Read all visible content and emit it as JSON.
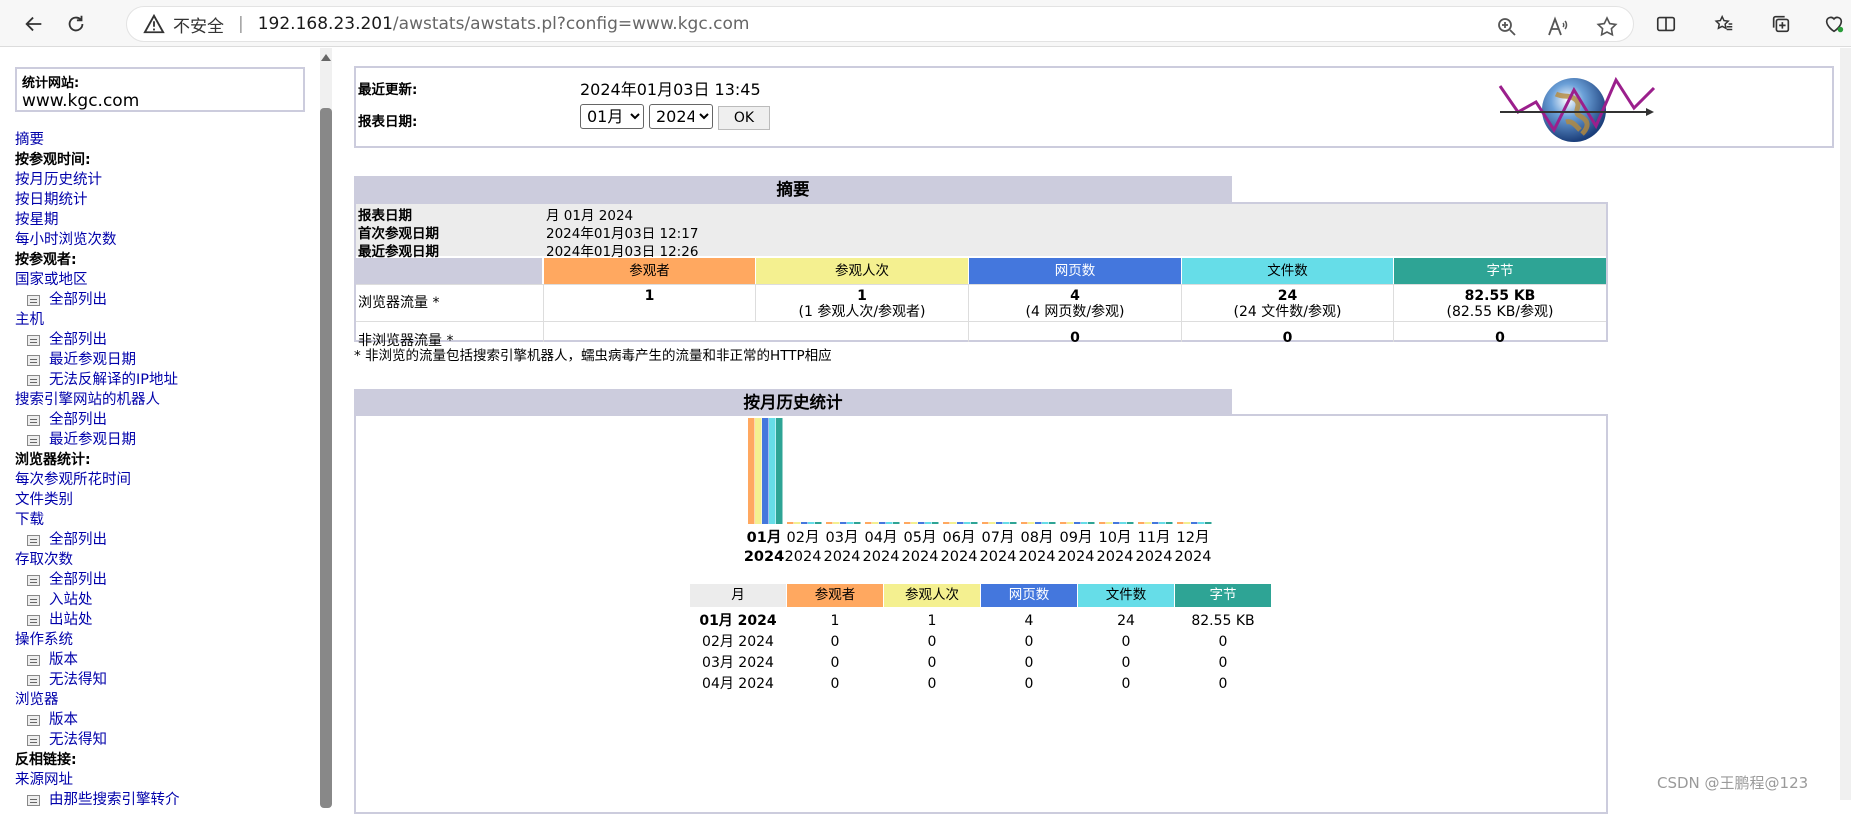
{
  "browser": {
    "insecure_label": "不安全",
    "url_host": "192.168.23.201",
    "url_path": "/awstats/awstats.pl?config=www.kgc.com"
  },
  "sidebar": {
    "site_label": "统计网站:",
    "site_value": "www.kgc.com",
    "items": [
      {
        "type": "link",
        "label": "摘要"
      },
      {
        "type": "head",
        "label": "按参观时间:"
      },
      {
        "type": "link",
        "label": "按月历史统计"
      },
      {
        "type": "link",
        "label": "按日期统计"
      },
      {
        "type": "link",
        "label": "按星期"
      },
      {
        "type": "link",
        "label": "每小时浏览次数"
      },
      {
        "type": "head",
        "label": "按参观者:"
      },
      {
        "type": "link",
        "label": "国家或地区"
      },
      {
        "type": "sub",
        "label": "全部列出"
      },
      {
        "type": "link",
        "label": "主机"
      },
      {
        "type": "sub",
        "label": "全部列出"
      },
      {
        "type": "sub",
        "label": "最近参观日期"
      },
      {
        "type": "sub",
        "label": "无法反解译的IP地址"
      },
      {
        "type": "link",
        "label": "搜索引擎网站的机器人"
      },
      {
        "type": "sub",
        "label": "全部列出"
      },
      {
        "type": "sub",
        "label": "最近参观日期"
      },
      {
        "type": "head",
        "label": "浏览器统计:"
      },
      {
        "type": "link",
        "label": "每次参观所花时间"
      },
      {
        "type": "link",
        "label": "文件类别"
      },
      {
        "type": "link",
        "label": "下载"
      },
      {
        "type": "sub",
        "label": "全部列出"
      },
      {
        "type": "link",
        "label": "存取次数"
      },
      {
        "type": "sub",
        "label": "全部列出"
      },
      {
        "type": "sub",
        "label": "入站处"
      },
      {
        "type": "sub",
        "label": "出站处"
      },
      {
        "type": "link",
        "label": "操作系统"
      },
      {
        "type": "sub",
        "label": "版本"
      },
      {
        "type": "sub",
        "label": "无法得知"
      },
      {
        "type": "link",
        "label": "浏览器"
      },
      {
        "type": "sub",
        "label": "版本"
      },
      {
        "type": "sub",
        "label": "无法得知"
      },
      {
        "type": "head",
        "label": "反相链接:"
      },
      {
        "type": "link",
        "label": "来源网址"
      },
      {
        "type": "sub",
        "label": "由那些搜索引擎转介"
      }
    ]
  },
  "header": {
    "last_update_label": "最近更新:",
    "last_update_value": "2024年01月03日 13:45",
    "report_date_label": "报表日期:",
    "month_select": "01月",
    "year_select": "2024",
    "ok_label": "OK"
  },
  "summary": {
    "title": "摘要",
    "rows": [
      {
        "k": "报表日期",
        "v": "月 01月 2024"
      },
      {
        "k": "首次参观日期",
        "v": "2024年01月03日 12:17"
      },
      {
        "k": "最近参观日期",
        "v": "2024年01月03日 12:26"
      }
    ],
    "columns": [
      "参观者",
      "参观人次",
      "网页数",
      "文件数",
      "字节"
    ],
    "colors": [
      "#ffa860",
      "#f4f090",
      "#4477dd",
      "#66dde8",
      "#2ea495"
    ],
    "browser_traffic_label": "浏览器流量 *",
    "browser_traffic": [
      {
        "main": "1",
        "sub": ""
      },
      {
        "main": "1",
        "sub": "(1 参观人次/参观者)"
      },
      {
        "main": "4",
        "sub": "(4 网页数/参观)"
      },
      {
        "main": "24",
        "sub": "(24 文件数/参观)"
      },
      {
        "main": "82.55 KB",
        "sub": "(82.55 KB/参观)"
      }
    ],
    "non_browser_label": "非浏览器流量 *",
    "non_browser": [
      "0",
      "0",
      "0"
    ],
    "footnote": "* 非浏览的流量包括搜索引擎机器人，蠕虫病毒产生的流量和非正常的HTTP相应"
  },
  "monthly": {
    "title": "按月历史统计",
    "months": [
      "01月",
      "02月",
      "03月",
      "04月",
      "05月",
      "06月",
      "07月",
      "08月",
      "09月",
      "10月",
      "11月",
      "12月"
    ],
    "year": "2024",
    "table_headers": [
      "月",
      "参观者",
      "参观人次",
      "网页数",
      "文件数",
      "字节"
    ],
    "rows": [
      [
        "01月 2024",
        "1",
        "1",
        "4",
        "24",
        "82.55 KB"
      ],
      [
        "02月 2024",
        "0",
        "0",
        "0",
        "0",
        "0"
      ],
      [
        "03月 2024",
        "0",
        "0",
        "0",
        "0",
        "0"
      ],
      [
        "04月 2024",
        "0",
        "0",
        "0",
        "0",
        "0"
      ]
    ]
  },
  "chart_data": {
    "type": "bar",
    "categories": [
      "01月 2024",
      "02月 2024",
      "03月 2024",
      "04月 2024",
      "05月 2024",
      "06月 2024",
      "07月 2024",
      "08月 2024",
      "09月 2024",
      "10月 2024",
      "11月 2024",
      "12月 2024"
    ],
    "series": [
      {
        "name": "参观者",
        "color": "#ffa860",
        "values": [
          1,
          0,
          0,
          0,
          0,
          0,
          0,
          0,
          0,
          0,
          0,
          0
        ]
      },
      {
        "name": "参观人次",
        "color": "#f4f090",
        "values": [
          1,
          0,
          0,
          0,
          0,
          0,
          0,
          0,
          0,
          0,
          0,
          0
        ]
      },
      {
        "name": "网页数",
        "color": "#4477dd",
        "values": [
          4,
          0,
          0,
          0,
          0,
          0,
          0,
          0,
          0,
          0,
          0,
          0
        ]
      },
      {
        "name": "文件数",
        "color": "#66dde8",
        "values": [
          24,
          0,
          0,
          0,
          0,
          0,
          0,
          0,
          0,
          0,
          0,
          0
        ]
      },
      {
        "name": "字节",
        "color": "#2ea495",
        "values": [
          82.55,
          0,
          0,
          0,
          0,
          0,
          0,
          0,
          0,
          0,
          0,
          0
        ]
      }
    ]
  },
  "watermark": "CSDN @王鹏程@123"
}
